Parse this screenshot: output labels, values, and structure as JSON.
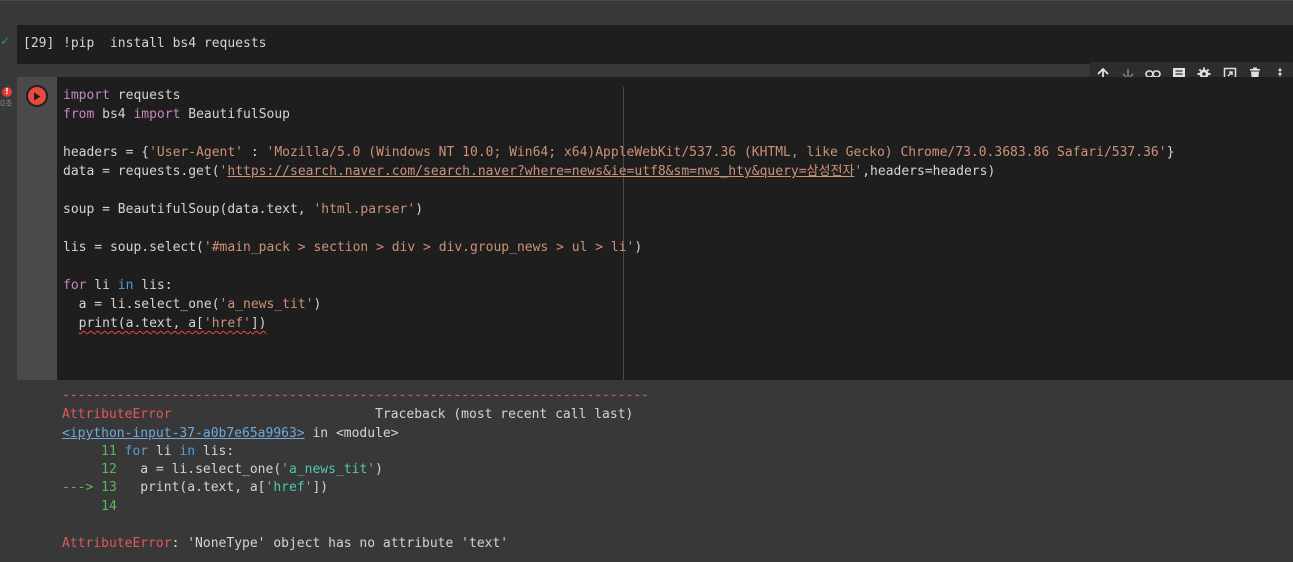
{
  "cell1": {
    "status_icon": "check-icon",
    "exec_count": "[29]",
    "code": "!pip  install bs4 requests"
  },
  "toolbar": {
    "icons": [
      "arrow-up-icon",
      "arrow-down-icon",
      "link-icon",
      "comment-icon",
      "gear-icon",
      "mirror-cell-icon",
      "trash-icon",
      "more-icon"
    ]
  },
  "cell2": {
    "error_badge": "!",
    "error_time": "0초",
    "run_icon": "play-icon",
    "lines": {
      "l1_kw": "import",
      "l1_rest": " requests",
      "l2_kw1": "from",
      "l2_mid": " bs4 ",
      "l2_kw2": "import",
      "l2_rest": " BeautifulSoup",
      "l3_a": "headers = {",
      "l3_key": "'User-Agent'",
      "l3_b": " : ",
      "l3_val": "'Mozilla/5.0 (Windows NT 10.0; Win64; x64)AppleWebKit/537.36 (KHTML, like Gecko) Chrome/73.0.3683.86 Safari/537.36'",
      "l3_c": "}",
      "l4_a": "data = requests.get(",
      "l4_q1": "'",
      "l4_url": "https://search.naver.com/search.naver?where=news&ie=utf8&sm=nws_hty&query=삼성전자",
      "l4_q2": "'",
      "l4_b": ",headers=headers)",
      "l5_a": "soup = BeautifulSoup(data.text, ",
      "l5_str": "'html.parser'",
      "l5_b": ")",
      "l6_a": "lis = soup.select(",
      "l6_str": "'#main_pack > section > div > div.group_news > ul > li'",
      "l6_b": ")",
      "l7_kw1": "for",
      "l7_mid": " li ",
      "l7_kw2": "in",
      "l7_rest": " lis:",
      "l8_a": "  a = li.select_one(",
      "l8_str": "'a_news_tit'",
      "l8_b": ")",
      "l9_indent": "  ",
      "l9_a": "print(a.text, a[",
      "l9_str": "'href'",
      "l9_b": "])"
    }
  },
  "output": {
    "dashes": "---------------------------------------------------------------------------",
    "error_name": "AttributeError",
    "traceback_label": "                          Traceback (most recent call last)",
    "input_link": "<ipython-input-37-a0b7e65a9963>",
    "in_module": " in <module>",
    "tb1_num": "     11 ",
    "tb1_kw1": "for",
    "tb1_mid": " li ",
    "tb1_kw2": "in",
    "tb1_rest": " lis:",
    "tb2_num": "     12 ",
    "tb2_a": "  a = li.select_one(",
    "tb2_str": "'a_news_tit'",
    "tb2_b": ")",
    "tb3_arrow": "---> 13 ",
    "tb3_a": "  print(a.text, a[",
    "tb3_str": "'href'",
    "tb3_b": "])",
    "tb4_num": "     14",
    "final_name": "AttributeError",
    "final_msg": ": 'NoneType' object has no attribute 'text'"
  },
  "colors": {
    "editor_bg": "#1e1e1e",
    "page_bg": "#383838",
    "keyword": "#c586c0",
    "string": "#ce9178",
    "error_red": "#e0585b",
    "success_green": "#2ea44f"
  }
}
